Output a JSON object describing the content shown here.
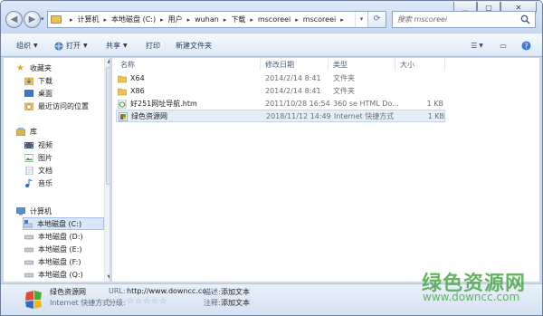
{
  "window": {
    "breadcrumb": [
      "计算机",
      "本地磁盘 (C:)",
      "用户",
      "wuhan",
      "下载",
      "mscoreei",
      "mscoreei"
    ],
    "search": {
      "placeholder": "搜索 mscoreei"
    }
  },
  "toolbar": {
    "organize": "组织",
    "open": "打开",
    "share": "共享",
    "print": "打印",
    "new_folder": "新建文件夹"
  },
  "sidebar": {
    "favorites": {
      "label": "收藏夹",
      "items": [
        "下载",
        "桌面",
        "最近访问的位置"
      ]
    },
    "libraries": {
      "label": "库",
      "items": [
        "视频",
        "图片",
        "文档",
        "音乐"
      ]
    },
    "computer": {
      "label": "计算机",
      "items": [
        "本地磁盘 (C:)",
        "本地磁盘 (D:)",
        "本地磁盘 (E:)",
        "本地磁盘 (F:)",
        "本地磁盘 (Q:)"
      ]
    }
  },
  "columns": {
    "name": "名称",
    "modified": "修改日期",
    "type": "类型",
    "size": "大小"
  },
  "files": [
    {
      "name": "X64",
      "modified": "2014/2/14 8:41",
      "type": "文件夹",
      "size": "",
      "icon": "folder-icon"
    },
    {
      "name": "X86",
      "modified": "2014/2/14 8:41",
      "type": "文件夹",
      "size": "",
      "icon": "folder-icon"
    },
    {
      "name": "好251网址导航.htm",
      "modified": "2011/10/28 16:54",
      "type": "360 se HTML Do...",
      "size": "1 KB",
      "icon": "html-file-icon"
    },
    {
      "name": "绿色资源网",
      "modified": "2018/11/12 14:49",
      "type": "Internet 快捷方式",
      "size": "1 KB",
      "icon": "internet-shortcut-icon"
    }
  ],
  "details": {
    "name": "绿色资源网",
    "kind": "Internet 快捷方式",
    "url_label": "URL:",
    "url_value": "http://www.downcc.co...",
    "rating_label": "分级:",
    "description_label": "描述:",
    "description_value": "添加文本",
    "comments_label": "注释:",
    "comments_value": "添加文本"
  },
  "watermark": {
    "title": "绿色资源网",
    "url": "www.downcc.com"
  },
  "colors": {
    "accent": "#1e395b",
    "watermark": "#4ca84a",
    "folder": "#e8c35a",
    "selection": "#e5eef8"
  }
}
